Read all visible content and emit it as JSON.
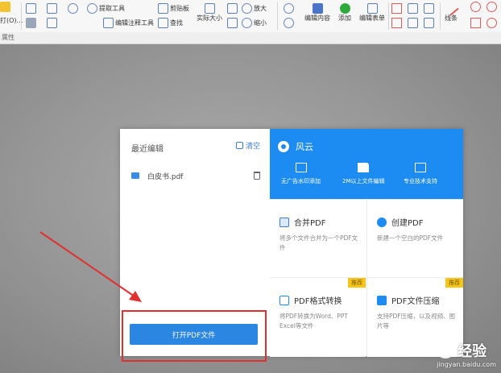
{
  "toolbar": {
    "left_label": "打(O)…",
    "sub_label": "属性",
    "extract_tool": "提取工具",
    "clipboard": "剪贴板",
    "actual_size": "实际大小",
    "zoom_in": "放大",
    "zoom_out": "缩小",
    "edit_content": "编辑内容",
    "add": "添加",
    "edit_form": "编辑表单",
    "edit_annotation_tool": "编辑注释工具",
    "find": "查找",
    "line": "线条"
  },
  "recent": {
    "title": "最近编辑",
    "clear_label": "清空",
    "files": [
      {
        "name": "白皮书.pdf"
      }
    ],
    "open_button": "打开PDF文件"
  },
  "brand": {
    "name": "风云",
    "features": [
      {
        "icon": "ad-icon",
        "label": "无广告水印添加"
      },
      {
        "icon": "folder-icon",
        "label": "2M以上文件编辑"
      },
      {
        "icon": "support-icon",
        "label": "专业技术支持"
      }
    ]
  },
  "tools": [
    {
      "title": "合并PDF",
      "desc": "将多个文件合并为一个PDF文件",
      "tag": ""
    },
    {
      "title": "创建PDF",
      "desc": "新建一个空白的PDF文件",
      "tag": ""
    },
    {
      "title": "PDF格式转换",
      "desc": "将PDF转换为Word、PPT Excel等文件",
      "tag": "推荐"
    },
    {
      "title": "PDF文件压缩",
      "desc": "支持PDF压缩，以及视频、图片等",
      "tag": "推荐"
    }
  ],
  "watermark": {
    "title": "经验",
    "url": "jingyan.baidu.com"
  },
  "colors": {
    "accent": "#1c8cf2",
    "button": "#2a86e0",
    "annotation": "#e03030",
    "tag": "#f5c518"
  }
}
